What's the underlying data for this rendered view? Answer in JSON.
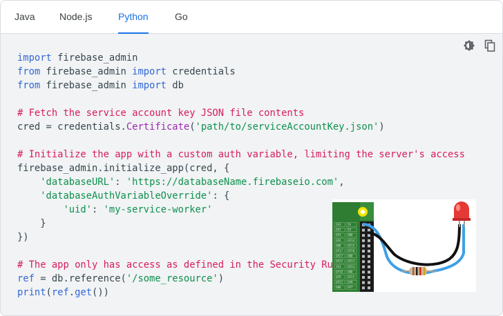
{
  "tabs": [
    {
      "label": "Java",
      "active": false
    },
    {
      "label": "Node.js",
      "active": false
    },
    {
      "label": "Python",
      "active": true
    },
    {
      "label": "Go",
      "active": false
    }
  ],
  "toolbar": {
    "theme_icon": "dark-theme-toggle-icon",
    "copy_icon": "copy-icon"
  },
  "code": {
    "l1": {
      "kw": "import",
      "rest": " firebase_admin"
    },
    "l2": {
      "kw1": "from",
      "mid": " firebase_admin ",
      "kw2": "import",
      "rest": " credentials"
    },
    "l3": {
      "kw1": "from",
      "mid": " firebase_admin ",
      "kw2": "import",
      "rest": " db"
    },
    "l5": {
      "comment": "# Fetch the service account key JSON file contents"
    },
    "l6": {
      "pre": "cred = credentials.",
      "cls": "Certificate",
      "p1": "(",
      "str": "'path/to/serviceAccountKey.json'",
      "p2": ")"
    },
    "l8": {
      "comment": "# Initialize the app with a custom auth variable, limiting the server's access"
    },
    "l9": {
      "text": "firebase_admin.initialize_app(cred, {"
    },
    "l10": {
      "indent": "    ",
      "key": "'databaseURL'",
      "sep": ": ",
      "val": "'https://databaseName.firebaseio.com'",
      "end": ","
    },
    "l11": {
      "indent": "    ",
      "key": "'databaseAuthVariableOverride'",
      "end": ": {"
    },
    "l12": {
      "indent": "        ",
      "key": "'uid'",
      "sep": ": ",
      "val": "'my-service-worker'"
    },
    "l13": {
      "text": "    }"
    },
    "l14": {
      "text": "})"
    },
    "l16": {
      "comment": "# The app only has access as defined in the Security Ru"
    },
    "l17": {
      "kw": "ref",
      "pre": " = db.reference(",
      "str": "'/some_resource'",
      "end": ")"
    },
    "l18": {
      "fn": "print",
      "p1": "(",
      "kw": "ref",
      "dot": ".",
      "fn2": "get",
      "end": "())"
    }
  },
  "diagram": {
    "pin_labels": [
      "3V3",
      "5V",
      "GP2",
      "5V",
      "GP3",
      "GND",
      "GP4",
      "GP14",
      "GND",
      "GP15",
      "GP17",
      "GP18",
      "GP27",
      "GND",
      "GP22",
      "GP23",
      "3V3",
      "GP24",
      "GP10",
      "GND",
      "GP9",
      "GP25",
      "GP11",
      "GP8",
      "GND",
      "GP7"
    ],
    "colors": {
      "board": "#2e7d32",
      "wire_blue": "#3ea0e6",
      "wire_black": "#111111",
      "led": "#e53935",
      "resistor": "#d9b48a"
    }
  }
}
